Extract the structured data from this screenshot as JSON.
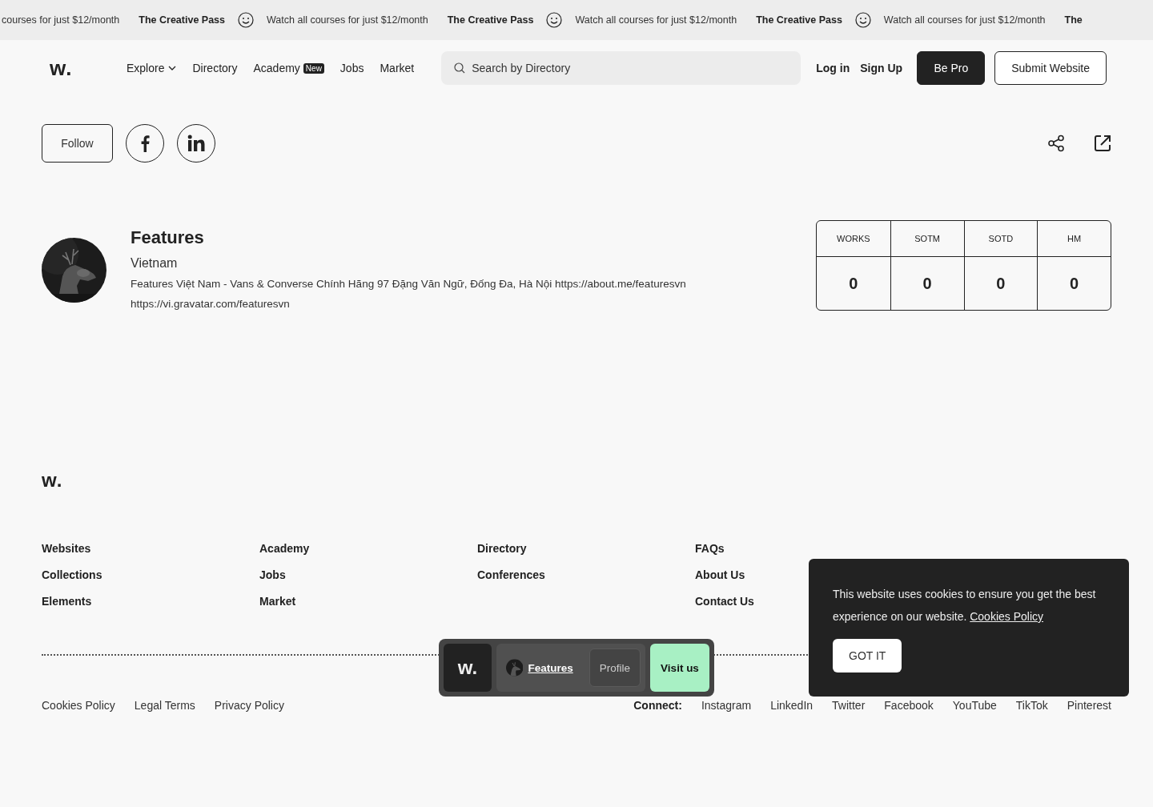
{
  "promo_bar": {
    "items": [
      {
        "kind": "text",
        "text": "courses for just $12/month"
      },
      {
        "kind": "title",
        "text": "The Creative Pass"
      },
      {
        "kind": "icon"
      },
      {
        "kind": "text",
        "text": "Watch all courses for just $12/month"
      },
      {
        "kind": "title",
        "text": "The Creative Pass"
      },
      {
        "kind": "icon"
      },
      {
        "kind": "text",
        "text": "Watch all courses for just $12/month"
      },
      {
        "kind": "title",
        "text": "The Creative Pass"
      },
      {
        "kind": "icon"
      },
      {
        "kind": "text",
        "text": "Watch all courses for just $12/month"
      },
      {
        "kind": "title",
        "text": "The"
      }
    ]
  },
  "header": {
    "logo": "w.",
    "nav": [
      {
        "label": "Explore",
        "dropdown": true
      },
      {
        "label": "Directory",
        "dropdown": false
      },
      {
        "label": "Academy",
        "dropdown": false,
        "badge": "New"
      },
      {
        "label": "Jobs",
        "dropdown": false
      },
      {
        "label": "Market",
        "dropdown": false
      }
    ],
    "search": {
      "placeholder": "Search by Directory"
    },
    "links": [
      "Log in",
      "Sign Up"
    ],
    "buttons": [
      {
        "label": "Be Pro",
        "kind": "primary"
      },
      {
        "label": "Submit Website",
        "kind": "outline"
      }
    ]
  },
  "profile_actions": {
    "follow": "Follow",
    "social": [
      {
        "kind": "facebook"
      },
      {
        "kind": "linkedin"
      }
    ]
  },
  "profile": {
    "name": "Features",
    "country": "Vietnam",
    "bio": "Features Việt Nam - Vans & Converse Chính Hãng 97 Đặng Văn Ngữ, Đống Đa, Hà Nội https://about.me/featuresvn",
    "link": "https://vi.gravatar.com/featuresvn",
    "stats": [
      {
        "label": "WORKS",
        "value": "0"
      },
      {
        "label": "SOTM",
        "value": "0"
      },
      {
        "label": "SOTD",
        "value": "0"
      },
      {
        "label": "HM",
        "value": "0"
      }
    ]
  },
  "footer": {
    "logo": "w.",
    "columns": [
      [
        "Websites",
        "Collections",
        "Elements"
      ],
      [
        "Academy",
        "Jobs",
        "Market"
      ],
      [
        "Directory",
        "Conferences"
      ],
      [
        "FAQs",
        "About Us",
        "Contact Us"
      ]
    ],
    "legal": [
      "Cookies Policy",
      "Legal Terms",
      "Privacy Policy"
    ],
    "connect_label": "Connect:",
    "connect": [
      "Instagram",
      "LinkedIn",
      "Twitter",
      "Facebook",
      "YouTube",
      "TikTok",
      "Pinterest"
    ]
  },
  "floating_bar": {
    "logo": "w.",
    "name": "Features",
    "profile": "Profile",
    "visit": "Visit us"
  },
  "cookie_banner": {
    "text": "This website uses cookies to ensure you get the best experience on our website.",
    "link": "Cookies Policy",
    "button": "GOT IT"
  }
}
